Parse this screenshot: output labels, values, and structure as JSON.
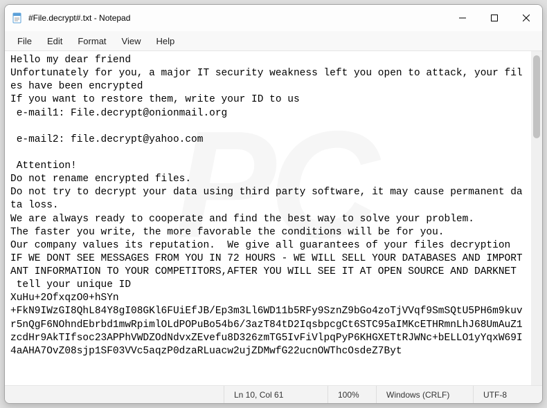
{
  "window": {
    "title": "#File.decrypt#.txt - Notepad"
  },
  "menu": {
    "file": "File",
    "edit": "Edit",
    "format": "Format",
    "view": "View",
    "help": "Help"
  },
  "content": {
    "text": "Hello my dear friend\nUnfortunately for you, a major IT security weakness left you open to attack, your files have been encrypted\nIf you want to restore them, write your ID to us\n e-mail1: File.decrypt@onionmail.org\n\n e-mail2: file.decrypt@yahoo.com\n\n Attention!\nDo not rename encrypted files.\nDo not try to decrypt your data using third party software, it may cause permanent data loss.\nWe are always ready to cooperate and find the best way to solve your problem.\nThe faster you write, the more favorable the conditions will be for you.\nOur company values its reputation.  We give all guarantees of your files decryption\nIF WE DONT SEE MESSAGES FROM YOU IN 72 HOURS - WE WILL SELL YOUR DATABASES AND IMPORTANT INFORMATION TO YOUR COMPETITORS,AFTER YOU WILL SEE IT AT OPEN SOURCE AND DARKNET\n tell your unique ID\nXuHu+2OfxqzO0+hSYn\n+FkN9IWzGI8QhL84Y8gI08GKl6FUiEfJB/Ep3m3Ll6WD11b5RFy9SznZ9bGo4zoTjVVqf9SmSQtU5PH6m9kuvr5nQgF6NOhndEbrbd1mwRpimlOLdPOPuBo54b6/3azT84tD2IqsbpcgCt6STC95aIMKcETHRmnLhJ68UmAuZ1zcdHr9AkTIfsoc23APPhVWDZOdNdvxZEvefu8D326zmTG5IvFiVlpqPyP6KHGXETtRJWNc+bELLO1yYqxW69I4aAHA7OvZ08sjp1SF03VVc5aqzP0dzaRLuacw2ujZDMwfG22ucnOWThcOsdeZ7Byt"
  },
  "statusbar": {
    "position": "Ln 10, Col 61",
    "zoom": "100%",
    "line_ending": "Windows (CRLF)",
    "encoding": "UTF-8"
  }
}
